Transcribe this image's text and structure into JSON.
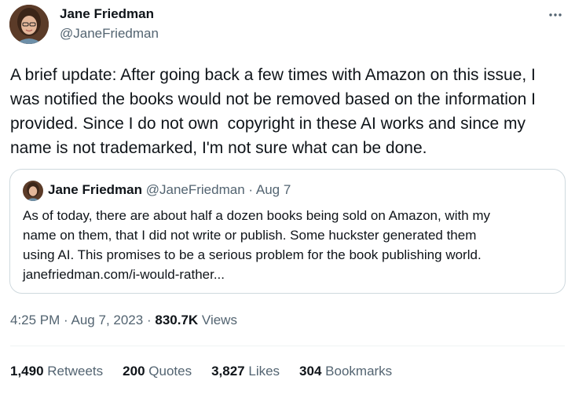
{
  "author": {
    "name": "Jane Friedman",
    "handle": "@JaneFriedman"
  },
  "tweet": {
    "text": "A brief update: After going back a few times with Amazon on this issue, I\nwas notified the books would not be removed based on the information I\nprovided. Since I do not own  copyright in these AI works and since my\nname is not trademarked, I'm not sure what can be done."
  },
  "quote": {
    "name": "Jane Friedman",
    "handle": "@JaneFriedman",
    "separator": "·",
    "date": "Aug 7",
    "lines": [
      "As of today, there are about half a dozen books being sold on Amazon, with my",
      "name on them, that I did not write or publish. Some huckster generated them",
      "using AI. This promises to be a serious problem for the book publishing world.",
      "janefriedman.com/i-would-rather..."
    ]
  },
  "meta": {
    "time": "4:25 PM",
    "dot1": "·",
    "date": "Aug 7, 2023",
    "dot2": "·",
    "views_count": "830.7K",
    "views_label": "Views"
  },
  "stats": [
    {
      "count": "1,490",
      "label": "Retweets"
    },
    {
      "count": "200",
      "label": "Quotes"
    },
    {
      "count": "3,827",
      "label": "Likes"
    },
    {
      "count": "304",
      "label": "Bookmarks"
    }
  ],
  "icons": {
    "more": "more-horizontal-icon"
  },
  "colors": {
    "text": "#0f1419",
    "secondary": "#536471",
    "border": "#cfd9de",
    "divider": "#eff3f4"
  }
}
